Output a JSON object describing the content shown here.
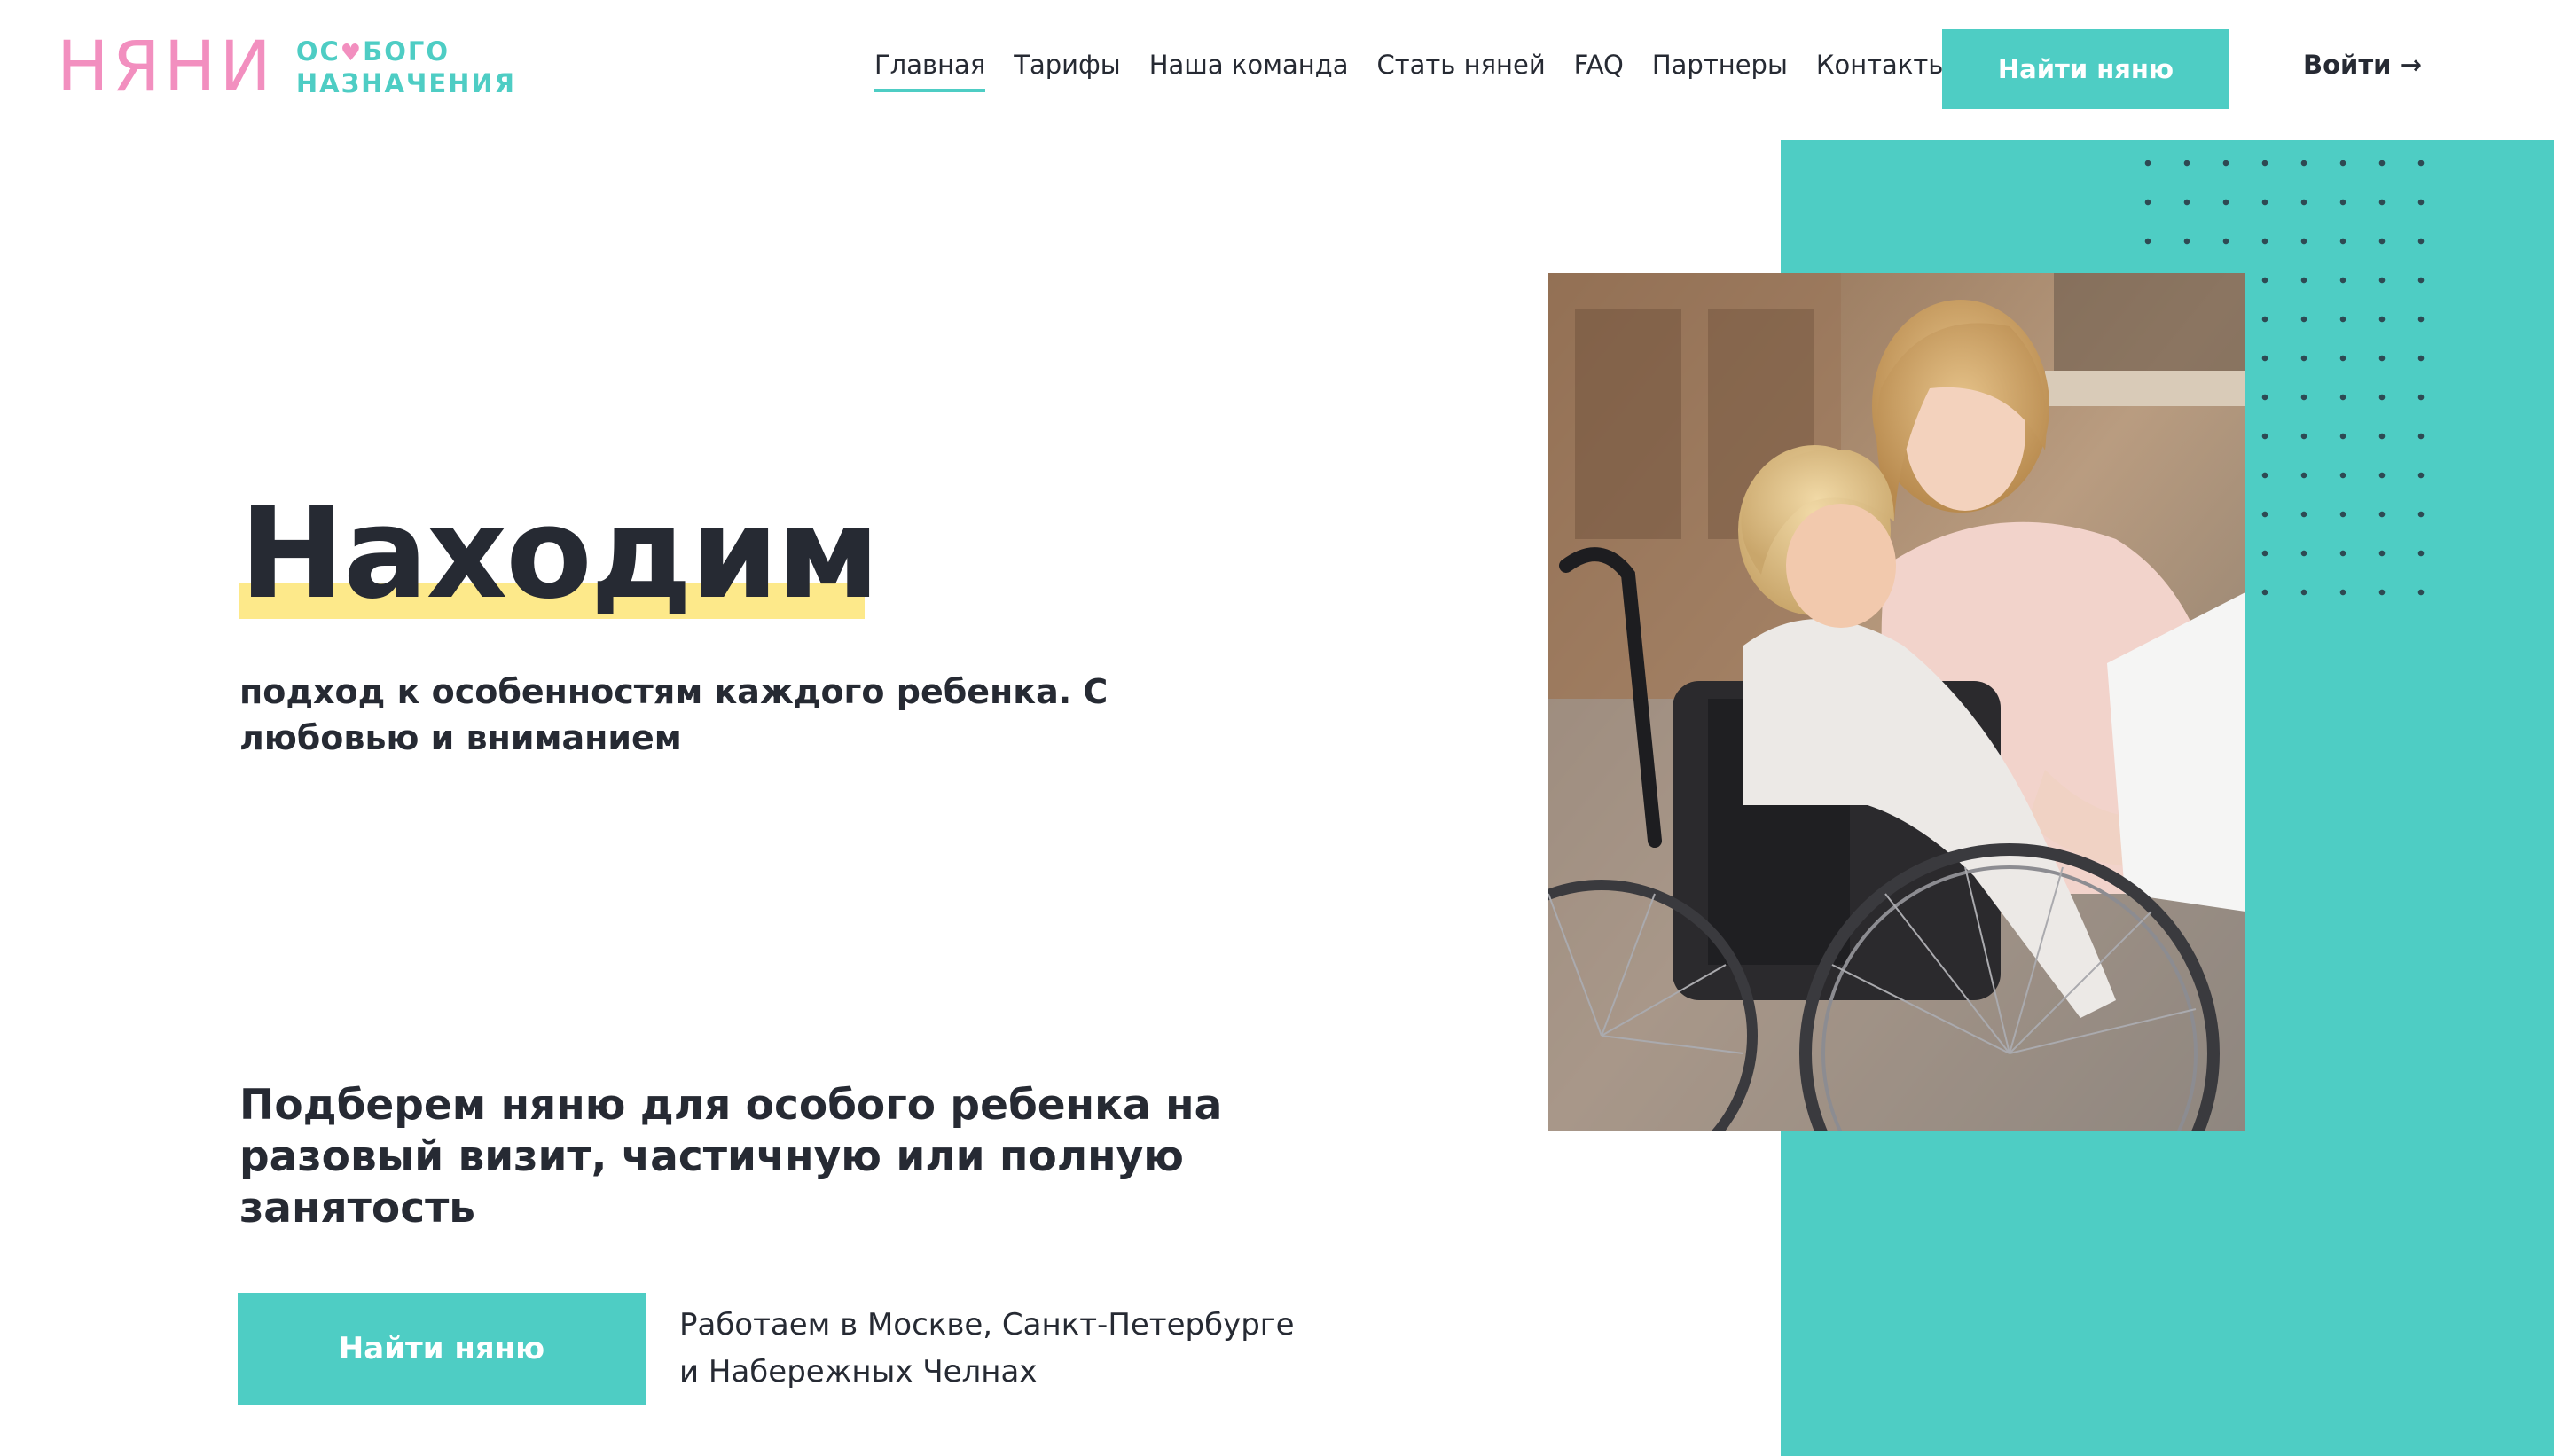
{
  "brand": {
    "name_main": "НЯНИ",
    "name_sub_line1_a": "ОС",
    "name_sub_heart": "♥",
    "name_sub_line1_b": "БОГО",
    "name_sub_line2": "НАЗНАЧЕНИЯ",
    "color_pink": "#f28fbf",
    "color_teal": "#4ecdc4"
  },
  "nav": {
    "items": [
      {
        "label": "Главная",
        "active": true
      },
      {
        "label": "Тарифы"
      },
      {
        "label": "Наша команда"
      },
      {
        "label": "Стать няней"
      },
      {
        "label": "FAQ"
      },
      {
        "label": "Партнеры"
      },
      {
        "label": "Контакты"
      }
    ],
    "cta_label": "Найти няню",
    "login_label": "Войти →"
  },
  "hero": {
    "title": "Находим",
    "subtitle": "подход к особенностям каждого ребенка. С любовью и вниманием",
    "lead": "Подберем няню для особого ребенка на разовый визит, частичную или полную занятость",
    "button_label": "Найти няню",
    "cities_line1": "Работаем в Москве, Санкт-Петербурге",
    "cities_line2": "и Набережных Челнах",
    "highlight_color": "#fde98a"
  },
  "photo": {
    "icon": "photo-nanny-with-child-in-wheelchair"
  }
}
